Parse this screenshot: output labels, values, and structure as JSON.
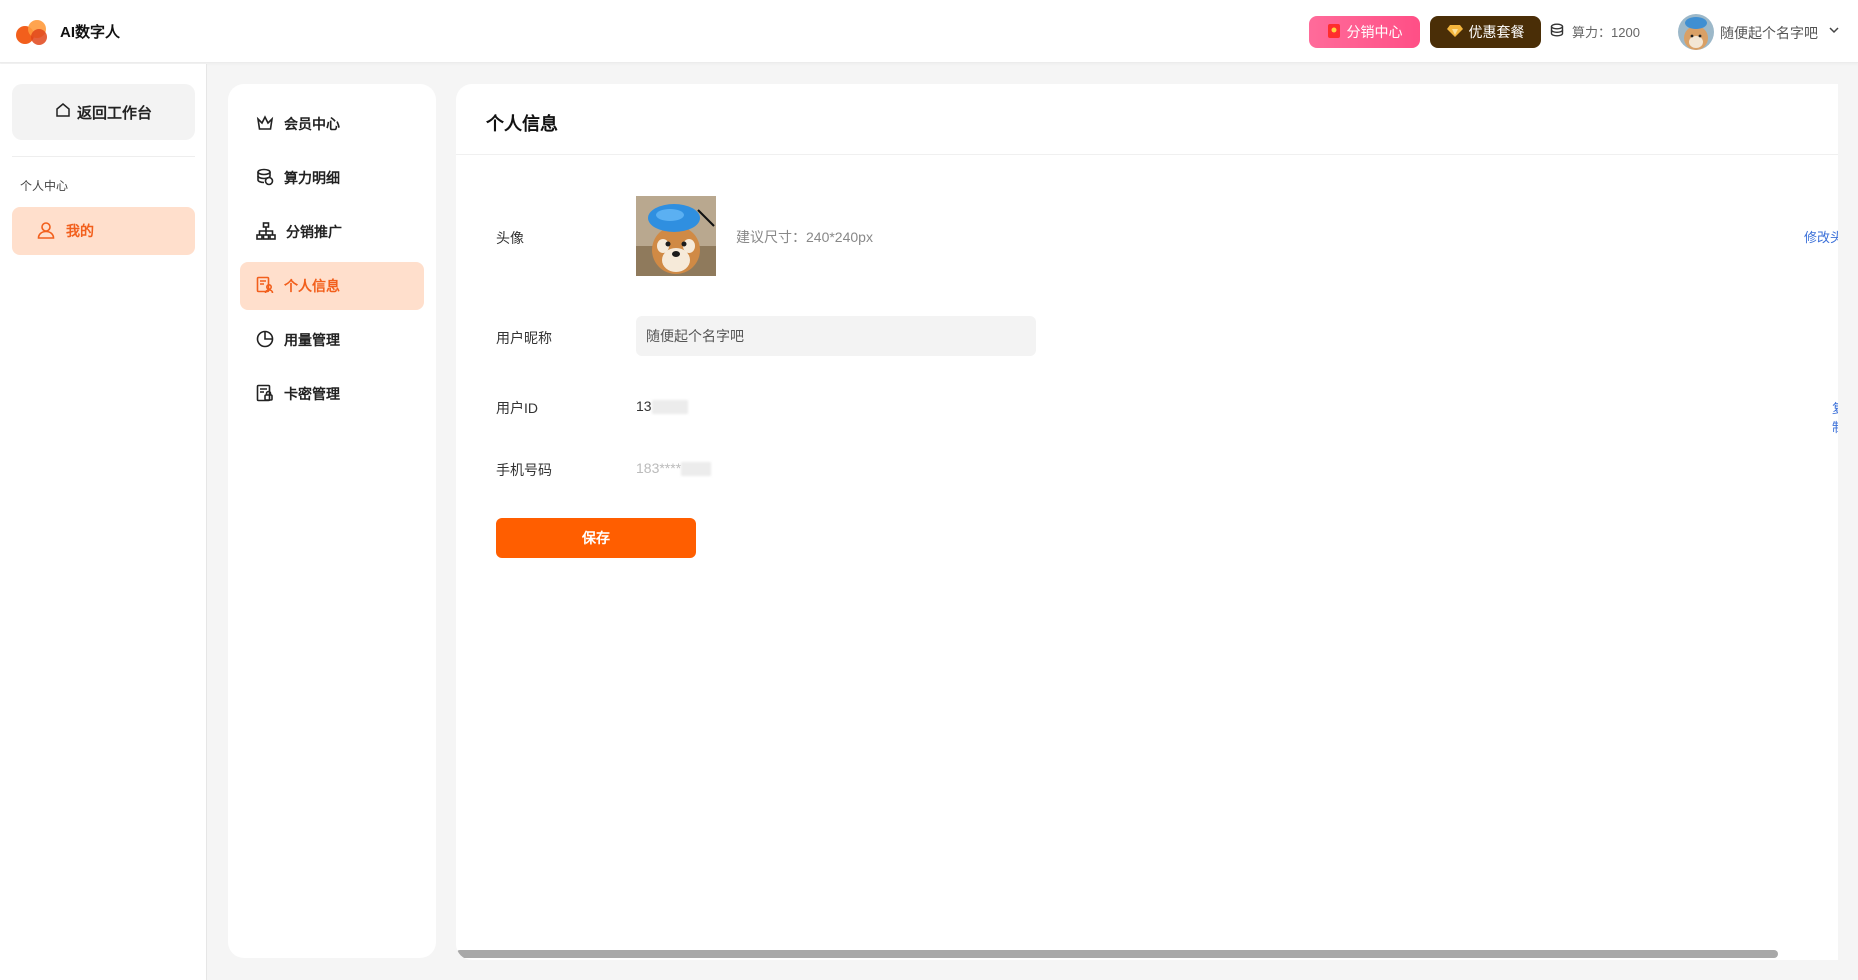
{
  "header": {
    "brand": "AI数字人",
    "distribution_label": "分销中心",
    "package_label": "优惠套餐",
    "power_text": "算力：1200",
    "username": "随便起个名字吧"
  },
  "sidebar": {
    "back_label": "返回工作台",
    "section_title": "个人中心",
    "item_label": "我的"
  },
  "menu": {
    "items": [
      {
        "label": "会员中心",
        "icon": "crown-icon"
      },
      {
        "label": "算力明细",
        "icon": "coins-icon"
      },
      {
        "label": "分销推广",
        "icon": "org-tree-icon"
      },
      {
        "label": "个人信息",
        "icon": "profile-doc-icon"
      },
      {
        "label": "用量管理",
        "icon": "pie-chart-icon"
      },
      {
        "label": "卡密管理",
        "icon": "card-key-icon"
      }
    ],
    "active_index": 3
  },
  "main": {
    "title": "个人信息",
    "avatar_label": "头像",
    "avatar_hint": "建议尺寸：240*240px",
    "modify_link": "修改头像",
    "nickname_label": "用户昵称",
    "nickname_value": "随便起个名字吧",
    "userid_label": "用户ID",
    "userid_value": "13",
    "copy_link": "复制",
    "phone_label": "手机号码",
    "phone_value": "183****",
    "save_label": "保存"
  },
  "colors": {
    "accent": "#ff5e00",
    "active_bg": "#ffdfcc",
    "active_text": "#f25f1c",
    "link": "#3a6fd8",
    "distribution_bg": "#ff4f86",
    "package_bg": "#4a2e07"
  }
}
